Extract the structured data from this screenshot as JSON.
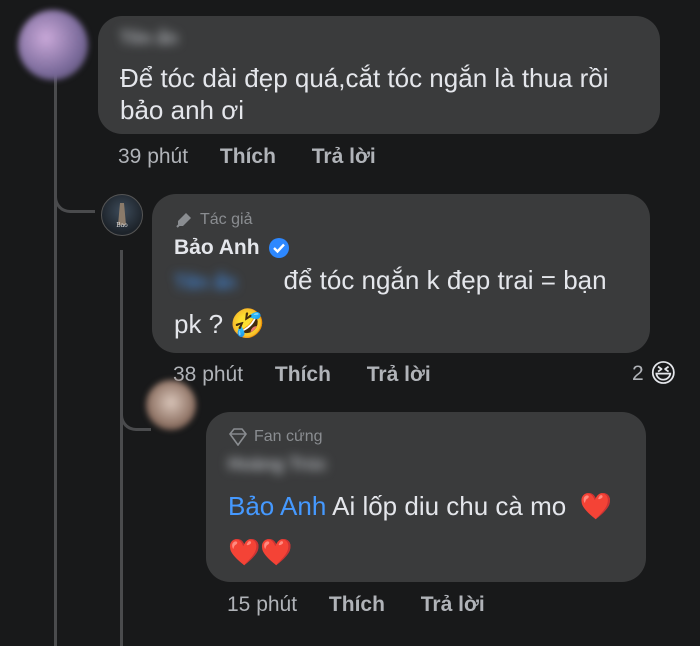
{
  "comment1": {
    "author": "Tên ẩn",
    "text_line1": "Để tóc dài đẹp quá,cắt tóc ngắn là thua rồi",
    "text_line2": "bảo anh ơi",
    "time": "39 phút",
    "like": "Thích",
    "reply": "Trả lời"
  },
  "comment2": {
    "badge": "Tác giả",
    "author": "Bảo Anh",
    "mention": "Tên ẩn",
    "text_line1": "để tóc ngắn k đẹp trai = bạn",
    "text_line2": "pk ?",
    "emoji": "🤣",
    "time": "38 phút",
    "like": "Thích",
    "reply": "Trả lời",
    "reaction_count": "2",
    "reaction_emoji": "😆"
  },
  "comment3": {
    "badge": "Fan cứng",
    "author": "Hoàng Trúc",
    "mention": "Bảo Anh",
    "text_line1": " Ai lốp diu chu cà mo",
    "hearts_line1": "❤️",
    "hearts_line2": "❤️❤️",
    "time": "15 phút",
    "like": "Thích",
    "reply": "Trả lời"
  },
  "colors": {
    "background": "#18191a",
    "bubble": "#3a3b3c",
    "mention": "#4599ff",
    "verified": "#2d88ff"
  }
}
